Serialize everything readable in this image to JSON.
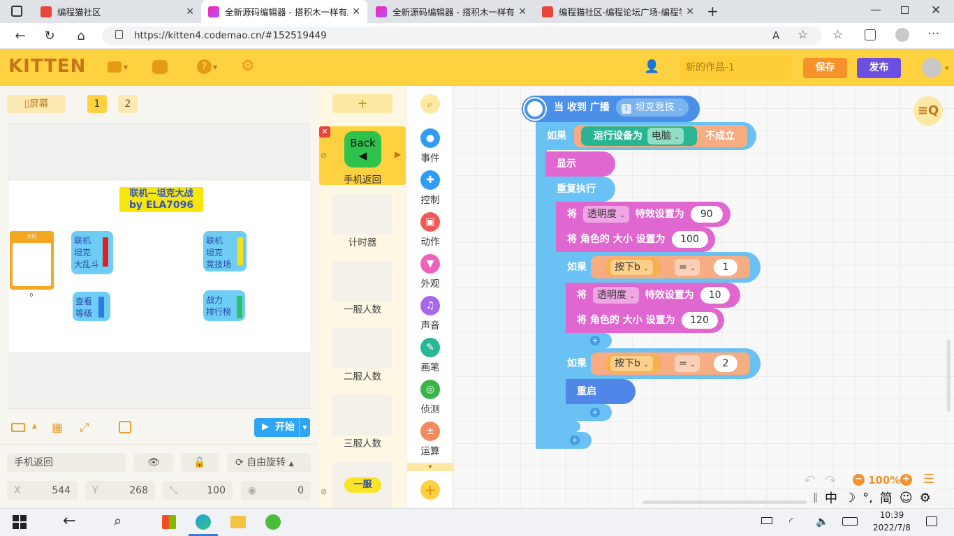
{
  "browser": {
    "tabs": [
      {
        "title": "编程猫社区",
        "active": false
      },
      {
        "title": "全新源码编辑器 - 搭积木一样有趣",
        "active": true
      },
      {
        "title": "全新源码编辑器 - 搭积木一样有趣",
        "active": false
      },
      {
        "title": "编程猫社区-编程论坛广场-编程学",
        "active": false
      }
    ],
    "url": "https://kitten4.codemao.cn/#152519449"
  },
  "header": {
    "logo": "KITTEN",
    "work_name": "新的作品-1",
    "save_label": "保存",
    "publish_label": "发布"
  },
  "stage": {
    "screen_label": "屏幕",
    "pages": [
      "1",
      "2"
    ],
    "title_line1": "联机—坦克大战",
    "title_line2": "by ELA7096",
    "buttons": [
      "联机\n坦克\n大乱斗",
      "联机\n坦克\n竞技场",
      "查看\n等级",
      "战力\n排行榜"
    ],
    "timer_label": "计时",
    "timer_value": "0",
    "start_label": "开始"
  },
  "properties": {
    "sprite_name": "手机返回",
    "rotation_label": "自由旋转",
    "x_label": "X",
    "x_value": "544",
    "y_label": "Y",
    "y_value": "268",
    "size_value": "100",
    "direction_value": "0"
  },
  "sprites": {
    "add_label": "+",
    "selected": {
      "name": "手机返回",
      "icon_text": "Back"
    },
    "items": [
      "计时器",
      "一服人数",
      "二服人数",
      "三服人数"
    ],
    "last_item": "一服"
  },
  "categories": [
    {
      "label": "事件",
      "color": "#2f9cf5"
    },
    {
      "label": "控制",
      "color": "#2f9cf5"
    },
    {
      "label": "动作",
      "color": "#f25858"
    },
    {
      "label": "外观",
      "color": "#ee62be"
    },
    {
      "label": "声音",
      "color": "#a866ea"
    },
    {
      "label": "画笔",
      "color": "#28b694"
    },
    {
      "label": "侦测",
      "color": "#38b448"
    },
    {
      "label": "运算",
      "color": "#f28a5f"
    }
  ],
  "code": {
    "hat_label": "当 收到 广播",
    "hat_badge": "1",
    "hat_value": "坦克竞技",
    "if_label": "如果",
    "cond_label": "运行设备为",
    "cond_value": "电脑",
    "cond_suffix": "不成立",
    "show_label": "显示",
    "repeat_label": "重复执行",
    "set_prefix": "将",
    "effect_value": "透明度",
    "effect_label": "特效设置为",
    "effect_num1": "90",
    "size_label": "将 角色的 大小 设置为",
    "size_num1": "100",
    "key_value": "按下b",
    "eq_value": "=",
    "cmp1": "1",
    "effect_num2": "10",
    "size_num2": "120",
    "cmp2": "2",
    "restart_label": "重启"
  },
  "workspace": {
    "zoom": "100%"
  },
  "taskbar": {
    "ime": "中",
    "ime_mode": "简",
    "time": "10:39",
    "date": "2022/7/8"
  }
}
